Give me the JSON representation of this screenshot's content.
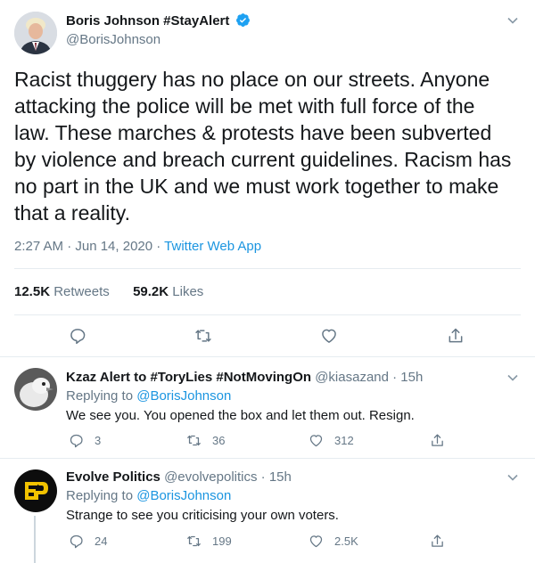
{
  "main_tweet": {
    "author_name": "Boris Johnson #StayAlert",
    "author_handle": "@BorisJohnson",
    "text": "Racist thuggery has no place on our streets. Anyone attacking the police will be met with full force of the law. These marches & protests have been subverted by violence and breach current guidelines. Racism has no part in the UK and we must work together to make that a reality.",
    "time": "2:27 AM · Jun 14, 2020 · ",
    "source": "Twitter Web App",
    "retweets_count": "12.5K",
    "retweets_label": "Retweets",
    "likes_count": "59.2K",
    "likes_label": "Likes"
  },
  "replies": [
    {
      "author_name": "Kzaz Alert to #ToryLies #NotMovingOn",
      "author_handle": "@kiasazand · 15h",
      "replying_prefix": "Replying to ",
      "replying_to": "@BorisJohnson",
      "text": "We see you. You opened the box and let them out. Resign.",
      "reply_count": "3",
      "retweet_count": "36",
      "like_count": "312"
    },
    {
      "author_name": "Evolve Politics",
      "author_handle": "@evolvepolitics · 15h",
      "replying_prefix": "Replying to ",
      "replying_to": "@BorisJohnson",
      "text": "Strange to see you criticising your own voters.",
      "reply_count": "24",
      "retweet_count": "199",
      "like_count": "2.5K"
    }
  ],
  "icons": {
    "verified": "verified-badge-icon",
    "chevron": "chevron-down-icon",
    "reply": "reply-icon",
    "retweet": "retweet-icon",
    "like": "heart-icon",
    "share": "share-icon"
  },
  "colors": {
    "link": "#1b95e0",
    "muted": "#657786",
    "verified": "#1da1f2",
    "divider": "#e6ecf0"
  }
}
